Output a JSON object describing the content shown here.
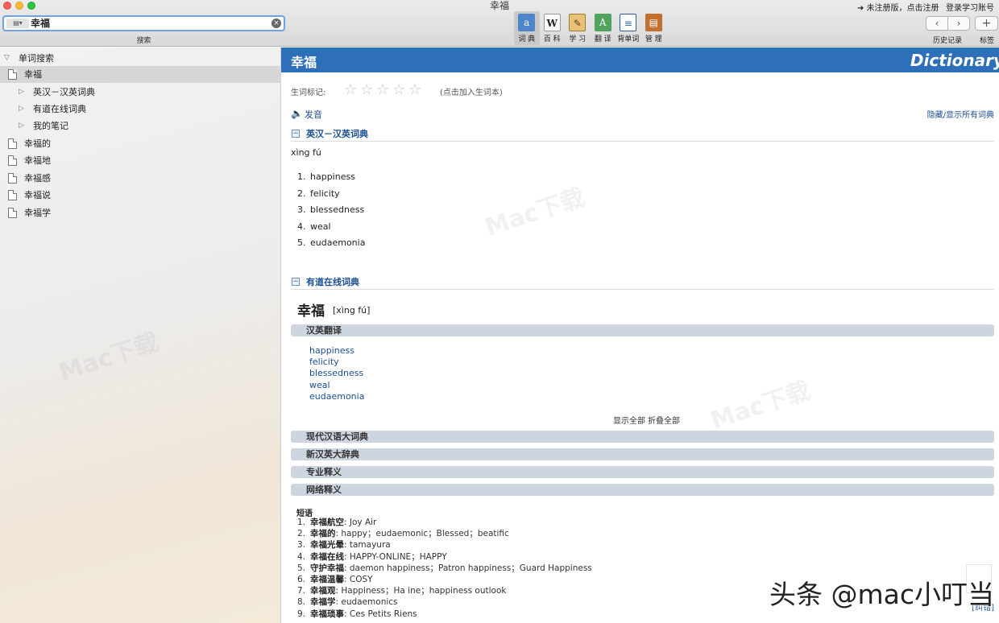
{
  "window": {
    "title": "幸福"
  },
  "search": {
    "value": "幸福",
    "caption": "搜索",
    "scope_label": "▤▾"
  },
  "toolbar": {
    "tools": [
      {
        "label": "词 典",
        "icon": "dictionary-icon",
        "glyph": "a",
        "active": true
      },
      {
        "label": "百 科",
        "icon": "wikipedia-icon",
        "glyph": "W",
        "active": false
      },
      {
        "label": "学 习",
        "icon": "study-icon",
        "glyph": "✎",
        "active": false
      },
      {
        "label": "翻 译",
        "icon": "translate-icon",
        "glyph": "A",
        "active": false
      },
      {
        "label": "背单词",
        "icon": "vocabulary-icon",
        "glyph": "≡",
        "active": false
      },
      {
        "label": "管 理",
        "icon": "manage-icon",
        "glyph": "▤",
        "active": false
      }
    ],
    "register": "➜ 未注册版，点击注册",
    "login": "登录学习账号",
    "back": "‹",
    "forward": "›",
    "add": "+",
    "history_label": "历史记录",
    "bookmark_label": "标签"
  },
  "sidebar": {
    "root": "单词搜索",
    "current": "幸福",
    "sub_items": [
      "英汉－汉英词典",
      "有道在线词典",
      "我的笔记"
    ],
    "related": [
      "幸福的",
      "幸福地",
      "幸福感",
      "幸福说",
      "幸福学"
    ]
  },
  "header": {
    "word": "幸福",
    "brand": "Dictionary"
  },
  "marking": {
    "label": "生词标记:",
    "star_glyph": "☆",
    "add_note": "(点击加入生词本)"
  },
  "pronounce": {
    "speaker": "🔈",
    "label": "发音",
    "toggle_all": "隐藏/显示所有词典"
  },
  "dict1": {
    "title": "英汉－汉英词典",
    "collapse": "−",
    "pinyin": "xìng fú",
    "items": [
      "happiness",
      "felicity",
      "blessedness",
      "weal",
      "eudaemonia"
    ]
  },
  "dict2": {
    "title": "有道在线词典",
    "collapse": "−",
    "word": "幸福",
    "pinyin": "[xìng fú]",
    "section_translation": "汉英翻译",
    "links": [
      "happiness",
      "felicity",
      "blessedness",
      "weal",
      "eudaemonia"
    ],
    "show_all": "显示全部",
    "fold_all": "折叠全部",
    "sections": [
      "现代汉语大词典",
      "新汉英大辞典",
      "专业释义",
      "网络释义"
    ],
    "phrase_title": "短语",
    "phrases": [
      {
        "term": "幸福航空",
        "def": ": Joy Air"
      },
      {
        "term": "幸福的",
        "def": ": happy；eudaemonic；Blessed；beatific"
      },
      {
        "term": "幸福光晕",
        "def": ": tamayura"
      },
      {
        "term": "幸福在线",
        "def": ": HAPPY-ONLINE；HAPPY"
      },
      {
        "term": "守护幸福",
        "def": ": daemon happiness；Patron happiness；Guard Happiness"
      },
      {
        "term": "幸福温馨",
        "def": ": COSY"
      },
      {
        "term": "幸福观",
        "def": ": Happiness；Ha ine；happiness outlook"
      },
      {
        "term": "幸福学",
        "def": ": eudaemonics"
      },
      {
        "term": "幸福琐事",
        "def": ": Ces Petits Riens"
      }
    ],
    "edit": "[纠错]"
  },
  "overlay": {
    "watermark": "头条 @mac小叮当",
    "site_mark": "Mac下载"
  }
}
